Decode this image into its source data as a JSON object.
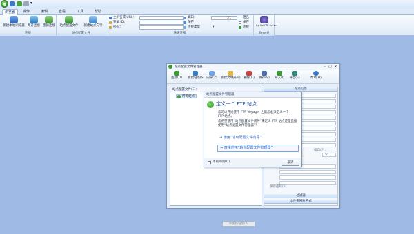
{
  "tabs": [
    "浏览器",
    "操作",
    "编辑",
    "查看",
    "工具",
    "帮助"
  ],
  "ribbon": {
    "connect_group": {
      "label": "连接",
      "buttons": [
        "新建本地浏览器",
        "断开连接",
        "重新连接"
      ]
    },
    "site_group": {
      "label": "站点配置文件",
      "buttons": [
        "站点配置文件",
        "新建站点向导"
      ]
    },
    "quick_connect": {
      "label": "快速连接",
      "host_label": "主机名或 URL：",
      "login_label": "登录 ID：",
      "password_label": "密码：",
      "port_label": "端口：",
      "port_value": "21",
      "anonymous_label": "匿名",
      "save_label": "保存",
      "connect_type_label": "连接类型",
      "connect_label": "连接"
    },
    "sftp_group": {
      "label": "Serv-U",
      "button": "By Itol FTP Server"
    }
  },
  "site_manager": {
    "title": "站点配置文件管理器",
    "toolbar": [
      "连接(O)",
      "新建站点(S)",
      "向导(Z)",
      "新建文件夹(F)",
      "删除(D)",
      "保存(V)",
      "导入(I)",
      "导出(E)",
      "帮助(H)"
    ],
    "left_header": "站点配置文件(E)：",
    "tree_root": "所有站点",
    "add_site_button": "添加新站点(A)",
    "right_headers": [
      "站点信息",
      "过滤器",
      "文件夹映射方式"
    ],
    "right_labels": [
      "端口(P)：",
      "保存密码(S)"
    ],
    "port_value": "21"
  },
  "dialog": {
    "title": "站点配置文件管理器",
    "heading": "定义一个 FTP 站点",
    "text_lines": [
      "您可以开始使用 FTP Voyager 之前您必须定义一个",
      "FTP 站点。",
      "您希望使用“站点配置文件向导”来定义 FTP 站点还是直接",
      "使用“站点配置文件管理器”？"
    ],
    "option_wizard": "→ 使用“站点配置文件向导”",
    "option_manager": "→ 直接使用“站点配置文件管理器”",
    "no_show_again": "不再询问(D)",
    "cancel": "取消"
  }
}
